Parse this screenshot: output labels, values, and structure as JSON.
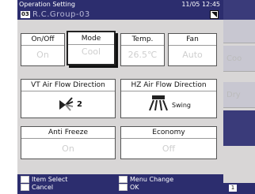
{
  "header": {
    "title": "Operation Setting",
    "time": "11/05 12:45"
  },
  "group": {
    "number": "03",
    "name": "R.C.Group-03"
  },
  "cards": {
    "on_off": {
      "label": "On/Off",
      "value": "On"
    },
    "mode": {
      "label": "Mode",
      "value": "Cool"
    },
    "temp": {
      "label": "Temp.",
      "value": "26.5℃"
    },
    "fan": {
      "label": "Fan",
      "value": "Auto"
    },
    "vt_air": {
      "label": "VT Air Flow Direction",
      "value": "2"
    },
    "hz_air": {
      "label": "HZ Air Flow Direction",
      "value": "Swing"
    },
    "anti_freeze": {
      "label": "Anti Freeze",
      "value": "On"
    },
    "economy": {
      "label": "Economy",
      "value": "Off"
    }
  },
  "hints": {
    "item_select": "Item Select",
    "cancel": "Cancel",
    "menu_change": "Menu Change",
    "ok": "OK"
  },
  "sidebar": {
    "items": [
      "Coo",
      "Dry"
    ]
  },
  "page": {
    "number": "1"
  },
  "colors": {
    "header_bg": "#2c2d6e",
    "content_bg": "#d8d6d6",
    "card_border": "#555555"
  }
}
